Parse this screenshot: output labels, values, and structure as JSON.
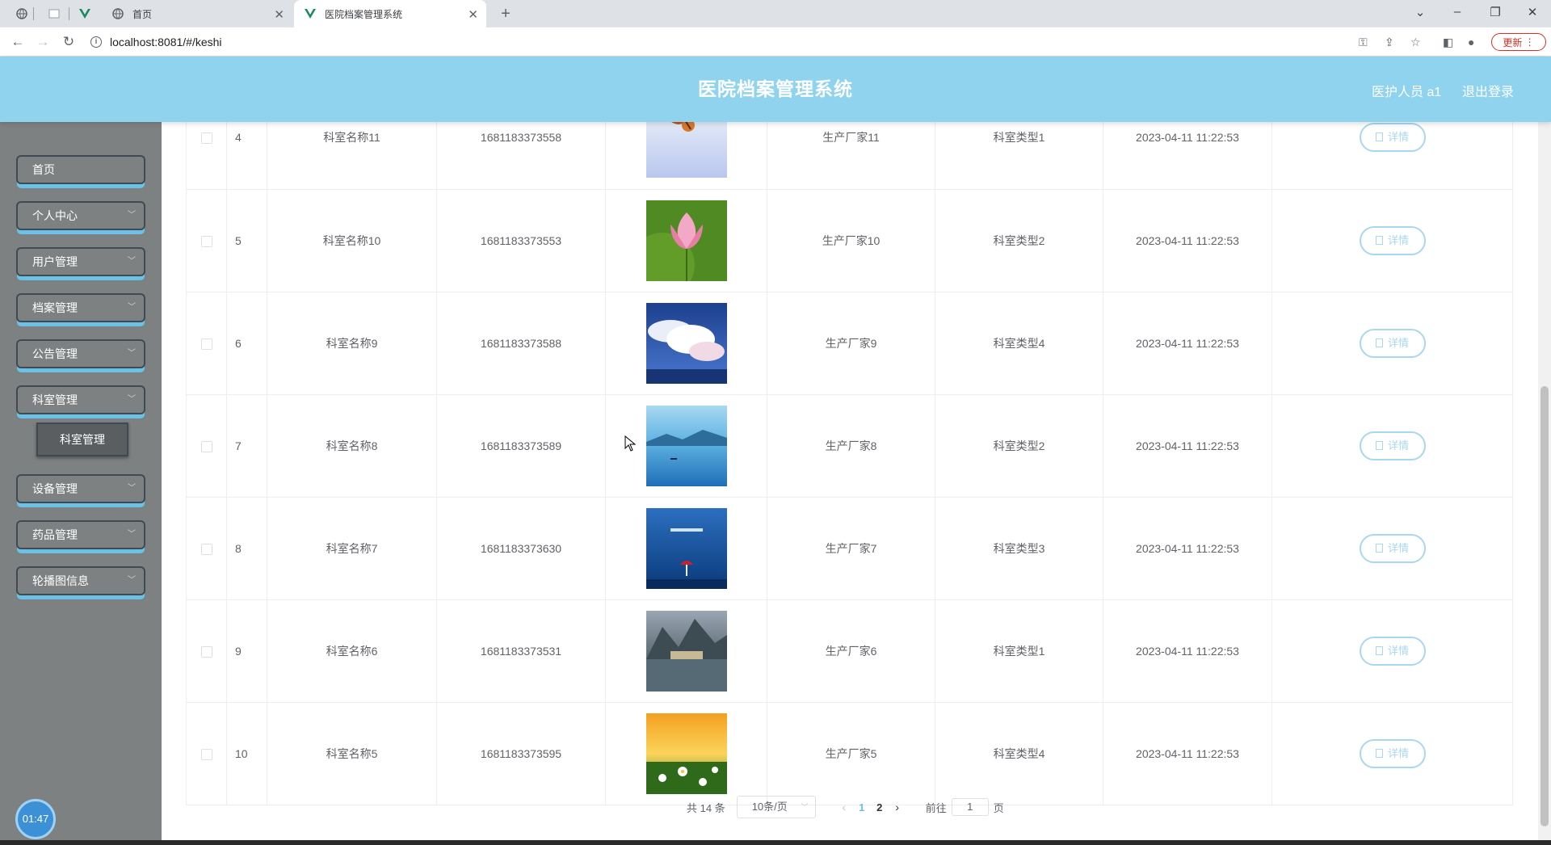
{
  "browser": {
    "tabs": [
      {
        "title": "首页",
        "favicon": "globe-icon",
        "active": false
      },
      {
        "title": "医院档案管理系统",
        "favicon": "vue-icon",
        "active": true
      }
    ],
    "url": "localhost:8081/#/keshi",
    "update_label": "更新"
  },
  "header": {
    "title": "医院档案管理系统",
    "user": "医护人员 a1",
    "logout": "退出登录"
  },
  "sidebar": {
    "items": [
      {
        "label": "首页",
        "has_sub": false
      },
      {
        "label": "个人中心",
        "has_sub": true
      },
      {
        "label": "用户管理",
        "has_sub": true
      },
      {
        "label": "档案管理",
        "has_sub": true
      },
      {
        "label": "公告管理",
        "has_sub": true
      },
      {
        "label": "科室管理",
        "has_sub": true
      },
      {
        "label": "设备管理",
        "has_sub": true
      },
      {
        "label": "药品管理",
        "has_sub": true
      },
      {
        "label": "轮播图信息",
        "has_sub": true
      }
    ],
    "submenu_active": "科室管理",
    "clock": "01:47"
  },
  "table": {
    "detail_label": "详情",
    "rows": [
      {
        "index": "4",
        "name": "科室名称11",
        "code": "1681183373558",
        "maker": "生产厂家11",
        "type": "科室类型1",
        "time": "2023-04-11 11:22:53",
        "image": "autumn-leaves"
      },
      {
        "index": "5",
        "name": "科室名称10",
        "code": "1681183373553",
        "maker": "生产厂家10",
        "type": "科室类型2",
        "time": "2023-04-11 11:22:53",
        "image": "lotus"
      },
      {
        "index": "6",
        "name": "科室名称9",
        "code": "1681183373588",
        "maker": "生产厂家9",
        "type": "科室类型4",
        "time": "2023-04-11 11:22:53",
        "image": "clouds"
      },
      {
        "index": "7",
        "name": "科室名称8",
        "code": "1681183373589",
        "maker": "生产厂家8",
        "type": "科室类型2",
        "time": "2023-04-11 11:22:53",
        "image": "lake"
      },
      {
        "index": "8",
        "name": "科室名称7",
        "code": "1681183373630",
        "maker": "生产厂家7",
        "type": "科室类型3",
        "time": "2023-04-11 11:22:53",
        "image": "sea-umbrella"
      },
      {
        "index": "9",
        "name": "科室名称6",
        "code": "1681183373531",
        "maker": "生产厂家6",
        "type": "科室类型1",
        "time": "2023-04-11 11:22:53",
        "image": "mountain-town"
      },
      {
        "index": "10",
        "name": "科室名称5",
        "code": "1681183373595",
        "maker": "生产厂家5",
        "type": "科室类型4",
        "time": "2023-04-11 11:22:53",
        "image": "daisies"
      }
    ]
  },
  "pagination": {
    "total_label": "共 14 条",
    "page_size": "10条/页",
    "pages": [
      "1",
      "2"
    ],
    "current_page": "1",
    "goto_label": "前往",
    "goto_value": "1",
    "page_unit": "页"
  },
  "colors": {
    "header_bg": "#8fd3ee",
    "sidebar_bg": "#7e8182",
    "accent": "#6bc1e6"
  }
}
